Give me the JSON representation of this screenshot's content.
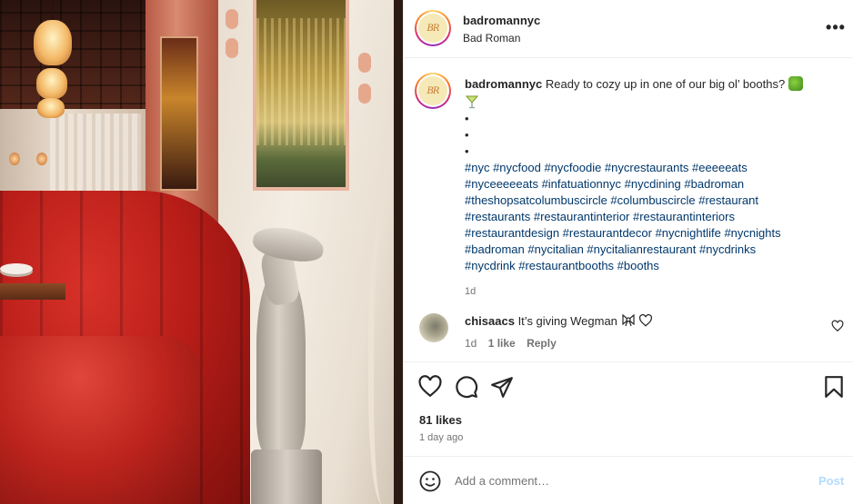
{
  "post": {
    "account": {
      "handle": "badromannyc",
      "location": "Bad Roman",
      "avatar_initials": "BR"
    },
    "more_label": "•••",
    "caption": {
      "handle": "badromannyc",
      "text": "Ready to cozy up in one of our big ol’ booths?",
      "emojis": [
        "snake-emoji",
        "cocktail-glass-emoji"
      ],
      "dots": [
        "•",
        "•",
        "•"
      ],
      "hashtag_lines": [
        "#nyc #nycfood #nycfoodie #nycrestaurants #eeeeeats",
        "#nyceeeeeats #infatuationnyc #nycdining #badroman",
        "#theshopsatcolumbuscircle #columbuscircle #restaurant",
        "#restaurants #restaurantinterior #restaurantinteriors",
        "#restaurantdesign #restaurantdecor #nycnightlife #nycnights",
        "#badroman #nycitalian #nycitalianrestaurant #nycdrinks",
        "#nycdrink #restaurantbooths #booths"
      ],
      "time": "1d"
    },
    "comment": {
      "handle": "chisaacs",
      "text": "It’s giving Wegman",
      "emojis": [
        "ribbon-emoji",
        "white-heart-emoji"
      ],
      "time": "1d",
      "likes": "1 like",
      "reply": "Reply"
    },
    "likes": "81 likes",
    "posted_ago": "1 day ago",
    "add_comment": {
      "placeholder": "Add a comment…",
      "post_label": "Post"
    }
  },
  "colors": {
    "text": "#262626",
    "muted": "#737373",
    "hashtag": "#00376b",
    "post_disabled": "#b3dbff",
    "divider": "#efefef"
  }
}
